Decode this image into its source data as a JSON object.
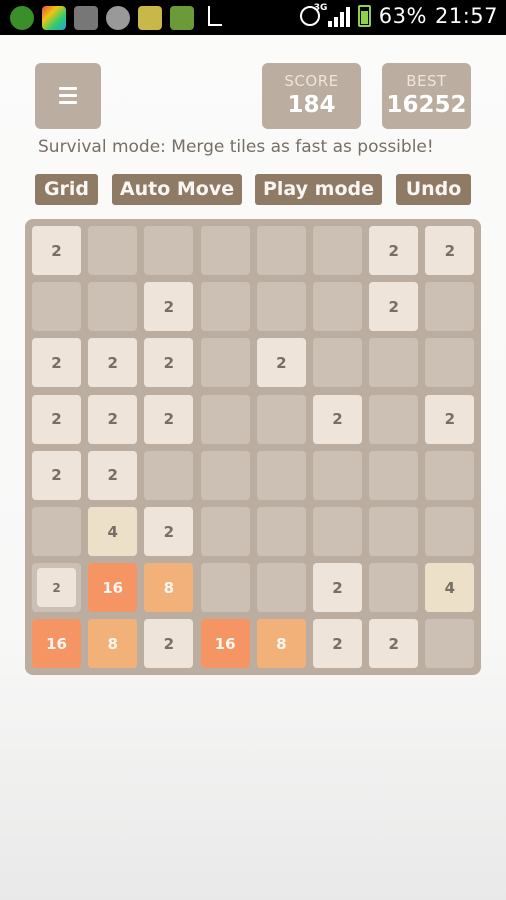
{
  "status_bar": {
    "battery": "63%",
    "time": "21:57",
    "network": "3G",
    "icons": [
      "app-icon-green",
      "app-icon-colorful",
      "app-icon-person",
      "app-icon-cloud",
      "app-icon-grid",
      "app-icon-chat",
      "usb-icon",
      "alarm-icon",
      "signal-icon",
      "battery-icon"
    ]
  },
  "header": {
    "menu_icon": "hamburger-menu-icon",
    "score_label": "SCORE",
    "score_value": "184",
    "best_label": "BEST",
    "best_value": "16252",
    "subtitle": "Survival mode: Merge tiles as fast as possible!"
  },
  "buttons": {
    "grid": "Grid",
    "auto_move": "Auto Move",
    "play_mode": "Play mode",
    "undo": "Undo"
  },
  "board": {
    "size": 8,
    "colors": {
      "background": "#bbada0",
      "t2": "#eee4da",
      "t4": "#ede0c8",
      "t8": "#f2b179",
      "t16": "#f59563"
    },
    "rows": [
      [
        2,
        null,
        null,
        null,
        null,
        null,
        2,
        2
      ],
      [
        null,
        null,
        2,
        null,
        null,
        null,
        2,
        null
      ],
      [
        2,
        2,
        2,
        null,
        2,
        null,
        null,
        null
      ],
      [
        2,
        2,
        2,
        null,
        null,
        2,
        null,
        2
      ],
      [
        2,
        2,
        null,
        null,
        null,
        null,
        null,
        null
      ],
      [
        null,
        4,
        2,
        null,
        null,
        null,
        null,
        null
      ],
      [
        2,
        16,
        8,
        null,
        null,
        2,
        null,
        4
      ],
      [
        16,
        8,
        2,
        16,
        8,
        2,
        2,
        null
      ]
    ]
  }
}
